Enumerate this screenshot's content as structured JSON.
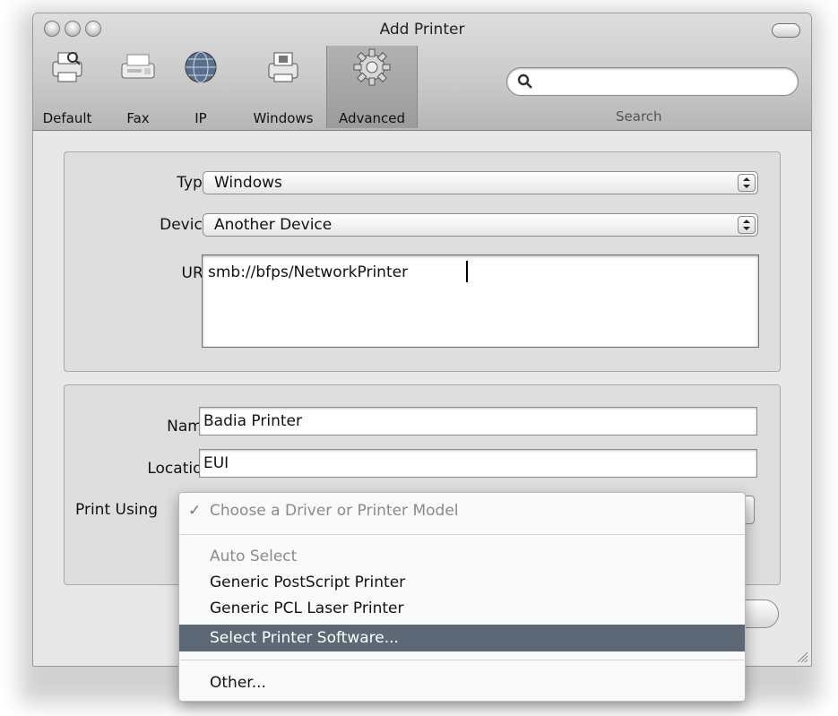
{
  "window": {
    "title": "Add Printer"
  },
  "toolbar": {
    "items": [
      {
        "label": "Default",
        "icon": "default-printer-icon"
      },
      {
        "label": "Fax",
        "icon": "fax-icon"
      },
      {
        "label": "IP",
        "icon": "ip-globe-icon"
      },
      {
        "label": "Windows",
        "icon": "windows-printer-icon"
      },
      {
        "label": "Advanced",
        "icon": "advanced-gear-icon",
        "selected": true
      }
    ],
    "search": {
      "label": "Search",
      "value": ""
    }
  },
  "connection": {
    "type_label": "Type:",
    "type_value": "Windows",
    "device_label": "Device:",
    "device_value": "Another Device",
    "url_label": "URL:",
    "url_value": "smb://bfps/NetworkPrinter"
  },
  "details": {
    "name_label": "Name:",
    "name_value": "Badia Printer",
    "location_label": "Location:",
    "location_value": "EUI",
    "print_using_label": "Print Using"
  },
  "print_using_menu": {
    "check_mark": "✓",
    "selected": "Choose a Driver or Printer Model",
    "items": [
      "Auto Select",
      "Generic PostScript Printer",
      "Generic PCL Laser Printer",
      "Select Printer Software...",
      "Other..."
    ],
    "highlighted": "Select Printer Software..."
  },
  "colors": {
    "highlight": "#5c6876"
  }
}
